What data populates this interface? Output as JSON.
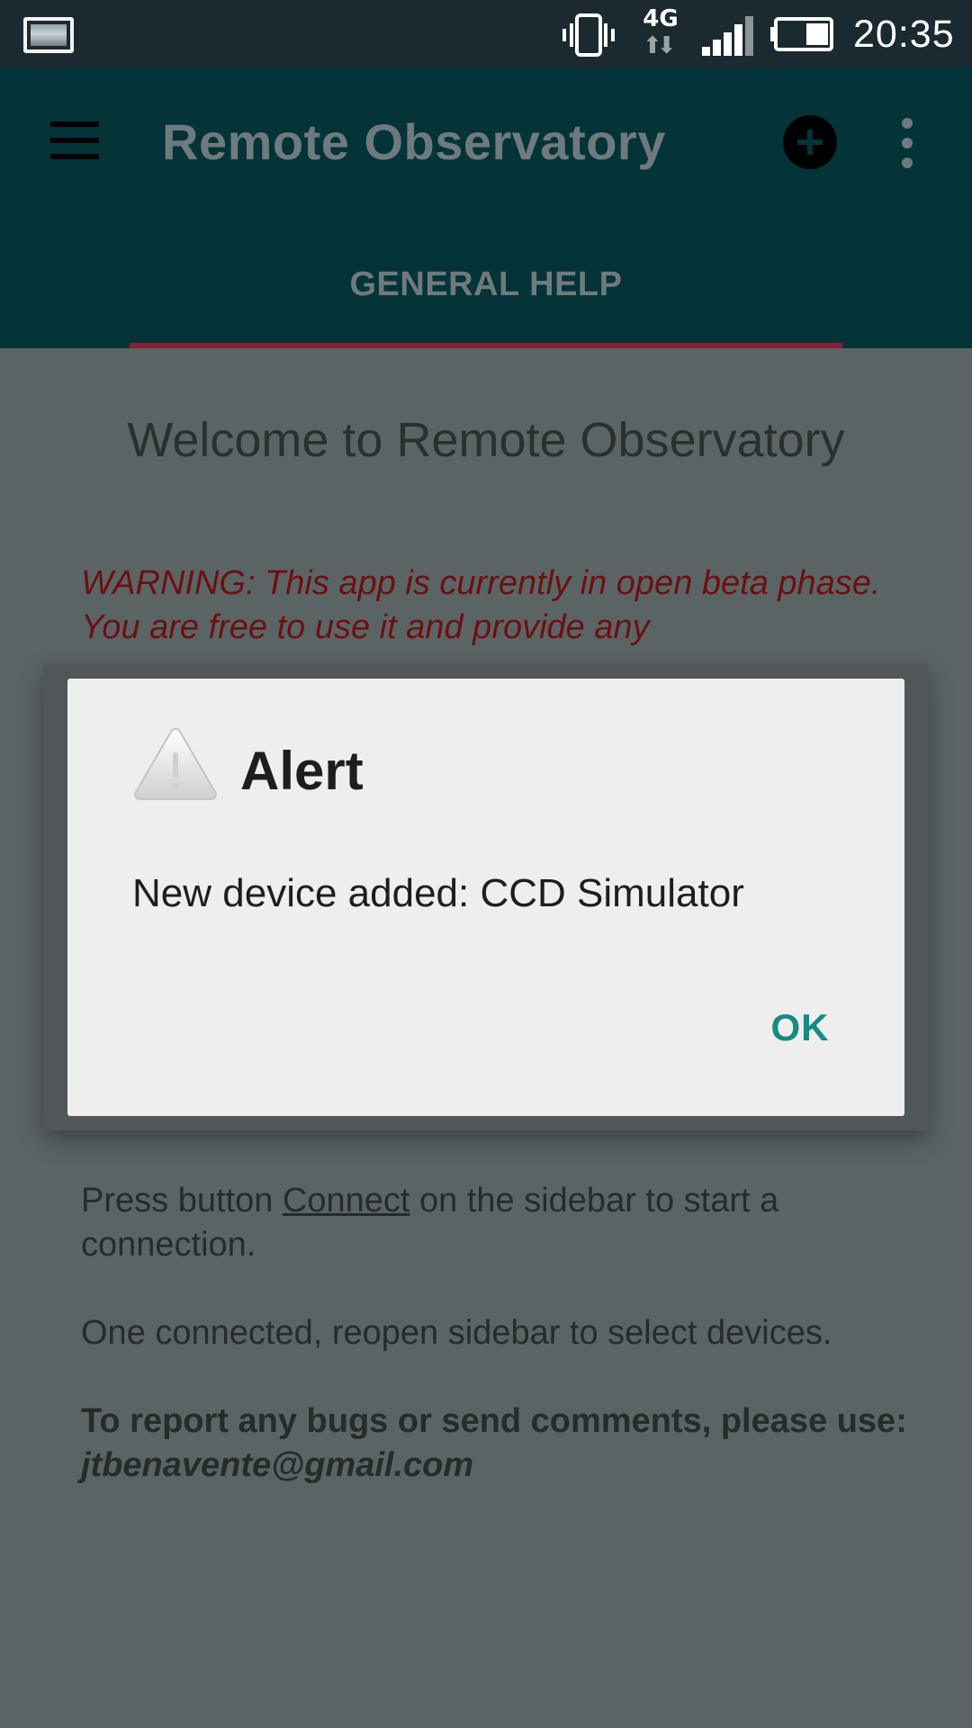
{
  "status_bar": {
    "time": "20:35",
    "network_type": "4G",
    "icons": [
      "gallery-icon",
      "vibrate-icon",
      "network-4g-icon",
      "signal-icon",
      "battery-icon"
    ]
  },
  "app_bar": {
    "title": "Remote Observatory",
    "tabs": [
      {
        "label": "GENERAL HELP"
      }
    ],
    "icons": [
      "menu-icon",
      "add-circle-icon",
      "overflow-menu-icon"
    ],
    "colors": {
      "background": "#043338",
      "tab_indicator": "#8a1f3a"
    }
  },
  "main": {
    "welcome_title": "Welcome to Remote Observatory",
    "warning_text": "WARNING: This app is currently in open beta phase. You are free to use it and provide any",
    "connect_prefix": "Press button ",
    "connect_link": "Connect",
    "connect_suffix": " on the sidebar to start a connection.",
    "select_devices_text": "One connected, reopen sidebar to select devices.",
    "report_text": "To report any bugs or send comments, please use: ",
    "report_email": "jtbenavente@gmail.com"
  },
  "dialog": {
    "title": "Alert",
    "message": "New device added: CCD Simulator",
    "ok_label": "OK",
    "icon": "warning-icon",
    "colors": {
      "ok": "#138c84",
      "background": "#eeeeee"
    }
  }
}
